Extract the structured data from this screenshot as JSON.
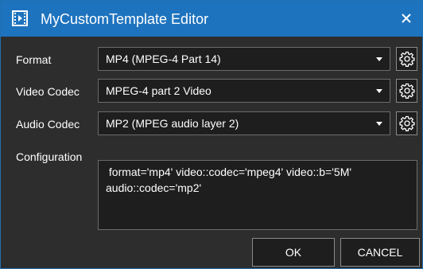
{
  "window": {
    "title": "MyCustomTemplate Editor",
    "close_glyph": "✕",
    "accent_color": "#1e73be"
  },
  "fields": {
    "format": {
      "label": "Format",
      "value": "MP4 (MPEG-4 Part 14)"
    },
    "video_codec": {
      "label": "Video Codec",
      "value": "MPEG-4 part 2 Video"
    },
    "audio_codec": {
      "label": "Audio Codec",
      "value": "MP2 (MPEG audio layer 2)"
    },
    "configuration": {
      "label": "Configuration",
      "value": " format='mp4' video::codec='mpeg4' video::b='5M'\naudio::codec='mp2'"
    }
  },
  "buttons": {
    "ok_label": "OK",
    "cancel_label": "CANCEL"
  },
  "icons": {
    "app": "film-icon",
    "close": "close-icon",
    "settings": "gear-icon",
    "dropdown": "chevron-down-icon"
  }
}
